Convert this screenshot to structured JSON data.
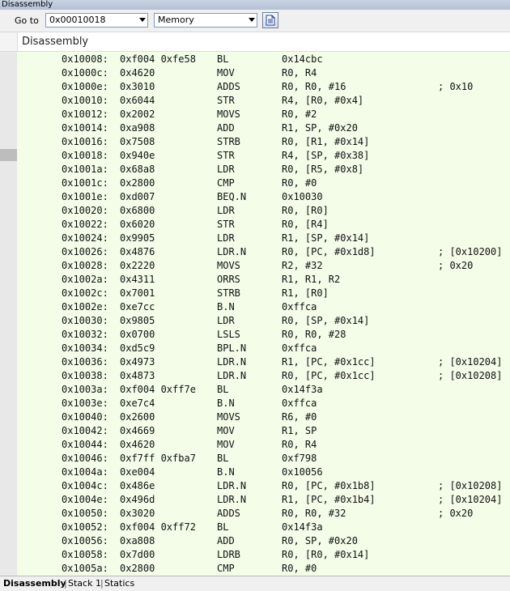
{
  "window": {
    "title": "Disassembly"
  },
  "toolbar": {
    "goto_label": "Go to",
    "address_value": "0x00010018",
    "memory_value": "Memory",
    "document_icon": "document-icon"
  },
  "panel": {
    "header_title": "Disassembly"
  },
  "rows": [
    {
      "addr": "0x10008:",
      "code": "0xf004 0xfe58",
      "mn": "BL",
      "op": "0x14cbc",
      "cm": ""
    },
    {
      "addr": "0x1000c:",
      "code": "0x4620",
      "mn": "MOV",
      "op": "R0, R4",
      "cm": ""
    },
    {
      "addr": "0x1000e:",
      "code": "0x3010",
      "mn": "ADDS",
      "op": "R0, R0, #16",
      "cm": "; 0x10"
    },
    {
      "addr": "0x10010:",
      "code": "0x6044",
      "mn": "STR",
      "op": "R4, [R0, #0x4]",
      "cm": ""
    },
    {
      "addr": "0x10012:",
      "code": "0x2002",
      "mn": "MOVS",
      "op": "R0, #2",
      "cm": ""
    },
    {
      "addr": "0x10014:",
      "code": "0xa908",
      "mn": "ADD",
      "op": "R1, SP, #0x20",
      "cm": ""
    },
    {
      "addr": "0x10016:",
      "code": "0x7508",
      "mn": "STRB",
      "op": "R0, [R1, #0x14]",
      "cm": ""
    },
    {
      "addr": "0x10018:",
      "code": "0x940e",
      "mn": "STR",
      "op": "R4, [SP, #0x38]",
      "cm": ""
    },
    {
      "addr": "0x1001a:",
      "code": "0x68a8",
      "mn": "LDR",
      "op": "R0, [R5, #0x8]",
      "cm": ""
    },
    {
      "addr": "0x1001c:",
      "code": "0x2800",
      "mn": "CMP",
      "op": "R0, #0",
      "cm": ""
    },
    {
      "addr": "0x1001e:",
      "code": "0xd007",
      "mn": "BEQ.N",
      "op": "0x10030",
      "cm": ""
    },
    {
      "addr": "0x10020:",
      "code": "0x6800",
      "mn": "LDR",
      "op": "R0, [R0]",
      "cm": ""
    },
    {
      "addr": "0x10022:",
      "code": "0x6020",
      "mn": "STR",
      "op": "R0, [R4]",
      "cm": ""
    },
    {
      "addr": "0x10024:",
      "code": "0x9905",
      "mn": "LDR",
      "op": "R1, [SP, #0x14]",
      "cm": ""
    },
    {
      "addr": "0x10026:",
      "code": "0x4876",
      "mn": "LDR.N",
      "op": "R0, [PC, #0x1d8]",
      "cm": "; [0x10200]"
    },
    {
      "addr": "0x10028:",
      "code": "0x2220",
      "mn": "MOVS",
      "op": "R2, #32",
      "cm": "; 0x20"
    },
    {
      "addr": "0x1002a:",
      "code": "0x4311",
      "mn": "ORRS",
      "op": "R1, R1, R2",
      "cm": ""
    },
    {
      "addr": "0x1002c:",
      "code": "0x7001",
      "mn": "STRB",
      "op": "R1, [R0]",
      "cm": ""
    },
    {
      "addr": "0x1002e:",
      "code": "0xe7cc",
      "mn": "B.N",
      "op": "0xffca",
      "cm": ""
    },
    {
      "addr": "0x10030:",
      "code": "0x9805",
      "mn": "LDR",
      "op": "R0, [SP, #0x14]",
      "cm": ""
    },
    {
      "addr": "0x10032:",
      "code": "0x0700",
      "mn": "LSLS",
      "op": "R0, R0, #28",
      "cm": ""
    },
    {
      "addr": "0x10034:",
      "code": "0xd5c9",
      "mn": "BPL.N",
      "op": "0xffca",
      "cm": ""
    },
    {
      "addr": "0x10036:",
      "code": "0x4973",
      "mn": "LDR.N",
      "op": "R1, [PC, #0x1cc]",
      "cm": "; [0x10204]"
    },
    {
      "addr": "0x10038:",
      "code": "0x4873",
      "mn": "LDR.N",
      "op": "R0, [PC, #0x1cc]",
      "cm": "; [0x10208]"
    },
    {
      "addr": "0x1003a:",
      "code": "0xf004 0xff7e",
      "mn": "BL",
      "op": "0x14f3a",
      "cm": ""
    },
    {
      "addr": "0x1003e:",
      "code": "0xe7c4",
      "mn": "B.N",
      "op": "0xffca",
      "cm": ""
    },
    {
      "addr": "0x10040:",
      "code": "0x2600",
      "mn": "MOVS",
      "op": "R6, #0",
      "cm": ""
    },
    {
      "addr": "0x10042:",
      "code": "0x4669",
      "mn": "MOV",
      "op": "R1, SP",
      "cm": ""
    },
    {
      "addr": "0x10044:",
      "code": "0x4620",
      "mn": "MOV",
      "op": "R0, R4",
      "cm": ""
    },
    {
      "addr": "0x10046:",
      "code": "0xf7ff 0xfba7",
      "mn": "BL",
      "op": "0xf798",
      "cm": ""
    },
    {
      "addr": "0x1004a:",
      "code": "0xe004",
      "mn": "B.N",
      "op": "0x10056",
      "cm": ""
    },
    {
      "addr": "0x1004c:",
      "code": "0x486e",
      "mn": "LDR.N",
      "op": "R0, [PC, #0x1b8]",
      "cm": "; [0x10208]"
    },
    {
      "addr": "0x1004e:",
      "code": "0x496d",
      "mn": "LDR.N",
      "op": "R1, [PC, #0x1b4]",
      "cm": "; [0x10204]"
    },
    {
      "addr": "0x10050:",
      "code": "0x3020",
      "mn": "ADDS",
      "op": "R0, R0, #32",
      "cm": "; 0x20"
    },
    {
      "addr": "0x10052:",
      "code": "0xf004 0xff72",
      "mn": "BL",
      "op": "0x14f3a",
      "cm": ""
    },
    {
      "addr": "0x10056:",
      "code": "0xa808",
      "mn": "ADD",
      "op": "R0, SP, #0x20",
      "cm": ""
    },
    {
      "addr": "0x10058:",
      "code": "0x7d00",
      "mn": "LDRB",
      "op": "R0, [R0, #0x14]",
      "cm": ""
    },
    {
      "addr": "0x1005a:",
      "code": "0x2800",
      "mn": "CMP",
      "op": "R0, #0",
      "cm": ""
    }
  ],
  "tabs": [
    {
      "label": "Disassembly",
      "active": true
    },
    {
      "label": "Stack 1",
      "active": false
    },
    {
      "label": "Statics",
      "active": false
    }
  ],
  "colors": {
    "code_background": "#f4fde8",
    "gutter": "#e8e8e8",
    "title_bar": "#c3cfe2"
  }
}
